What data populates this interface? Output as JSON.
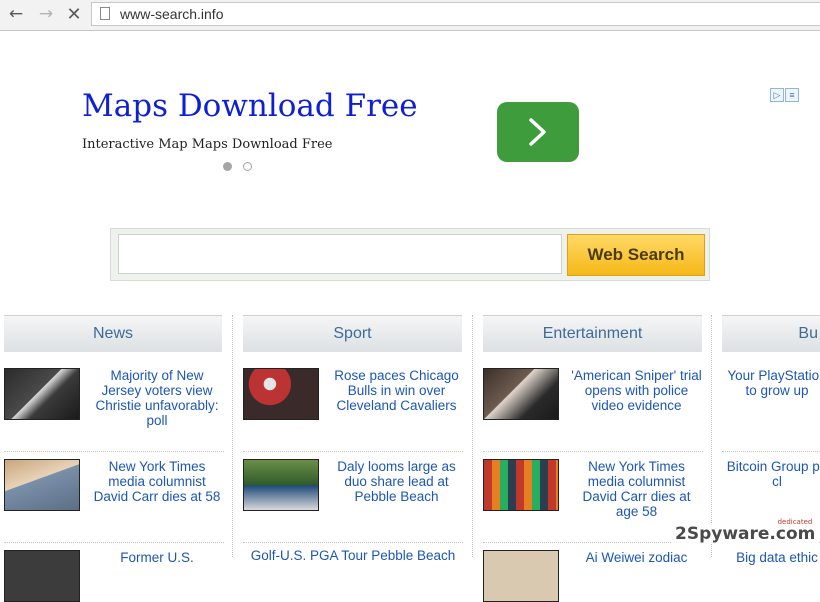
{
  "browser": {
    "url": "www-search.info"
  },
  "ad": {
    "title": "Maps Download Free",
    "subtitle": "Interactive Map Maps Download Free",
    "button_color": "#3e9c3c"
  },
  "search": {
    "value": "",
    "button_label": "Web Search"
  },
  "columns": [
    {
      "title": "News",
      "items": [
        "Majority of New Jersey voters view Christie unfavorably: poll",
        "New York Times media columnist David Carr dies at 58",
        "Former U.S."
      ]
    },
    {
      "title": "Sport",
      "items": [
        "Rose paces Chicago Bulls in win over Cleveland Cavaliers",
        "Daly looms large as duo share lead at Pebble Beach",
        "Golf-U.S. PGA Tour Pebble Beach"
      ]
    },
    {
      "title": "Entertainment",
      "items": [
        "'American Sniper' trial opens with police video evidence",
        "New York Times media columnist David Carr dies at age 58",
        "Ai Weiwei zodiac"
      ]
    },
    {
      "title": "Bu",
      "items": [
        "Your PlayStation to grow up",
        "Bitcoin Group pu cl",
        "Big data ethic"
      ]
    }
  ],
  "watermark": {
    "text": "2Spyware.com",
    "tag": "dedicated"
  }
}
